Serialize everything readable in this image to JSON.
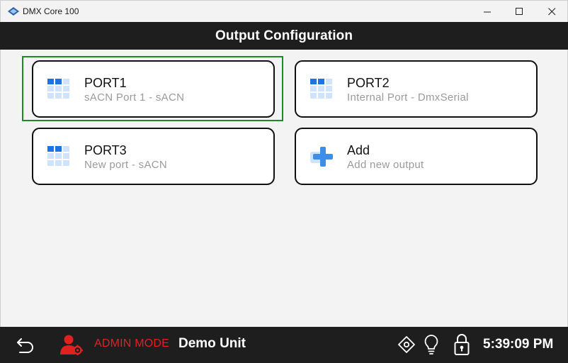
{
  "window": {
    "title": "DMX Core 100",
    "minimize_glyph": "—",
    "maximize_glyph": "☐",
    "close_glyph": "✕"
  },
  "header": {
    "title": "Output Configuration"
  },
  "outputs": [
    {
      "title": "PORT1",
      "subtitle": "sACN Port 1 - sACN",
      "icon": "grid-icon",
      "selected": true
    },
    {
      "title": "PORT2",
      "subtitle": "Internal Port - DmxSerial",
      "icon": "grid-icon",
      "selected": false
    },
    {
      "title": "PORT3",
      "subtitle": "New port - sACN",
      "icon": "grid-icon",
      "selected": false
    },
    {
      "title": "Add",
      "subtitle": "Add new output",
      "icon": "plus-icon",
      "selected": false
    }
  ],
  "statusbar": {
    "mode_label": "ADMIN MODE",
    "unit_name": "Demo Unit",
    "time": "5:39:09 PM"
  },
  "colors": {
    "accent_blue": "#1a73e8",
    "light_blue": "#cfe3ff",
    "admin_red": "#e12020",
    "focus_green": "#1f8a1f",
    "dark_bar": "#1e1e1e"
  }
}
